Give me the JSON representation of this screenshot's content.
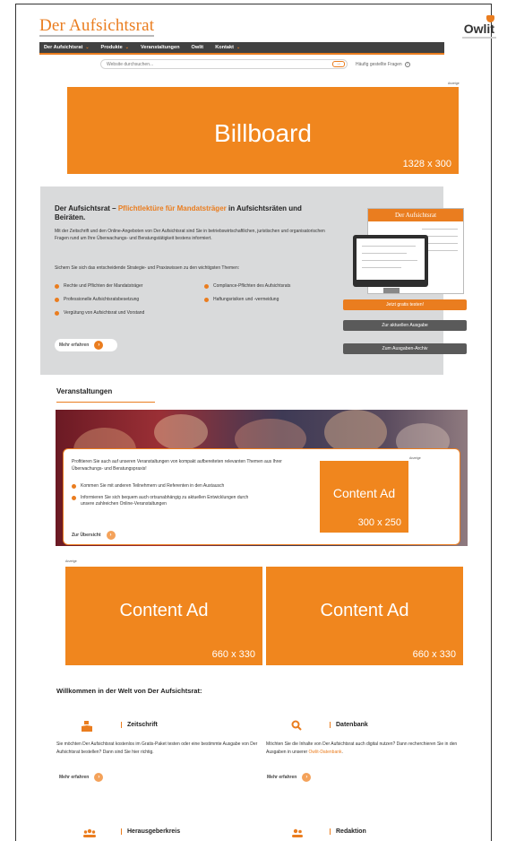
{
  "header": {
    "logo": "Der Aufsichtsrat",
    "brand": "Owlit",
    "nav": [
      {
        "label": "Der Aufsichtsrat",
        "has_dropdown": true
      },
      {
        "label": "Produkte",
        "has_dropdown": true
      },
      {
        "label": "Veranstaltungen",
        "has_dropdown": false
      },
      {
        "label": "Owlit",
        "has_dropdown": false
      },
      {
        "label": "Kontakt",
        "has_dropdown": true
      }
    ],
    "search_placeholder": "Website durchsuchen...",
    "search_button": "→",
    "faq": "Häufig gestellte Fragen",
    "faq_icon": "?"
  },
  "colors": {
    "accent": "#ea7d1f",
    "nav_bg": "#414141",
    "feature_bg": "#d9dadb",
    "ad_bg": "#f0861e"
  },
  "ads": {
    "label": "Anzeige",
    "billboard": {
      "title": "Billboard",
      "size": "1328 x 300"
    },
    "event_ad": {
      "title": "Content Ad",
      "size": "300 x 250"
    },
    "content_left": {
      "title": "Content Ad",
      "size": "660 x 330"
    },
    "content_right": {
      "title": "Content Ad",
      "size": "660 x 330"
    }
  },
  "feature": {
    "heading_pre": "Der Aufsichtsrat – ",
    "heading_highlight": "Pflichtlektüre für Mandatsträger",
    "heading_post": " in Aufsichtsräten und Beiräten.",
    "intro": "Mit der Zeitschrift und den Online-Angeboten von Der Aufsichtsrat sind Sie in betriebswirtschaftlichen, juristischen und organisatorischen Fragen rund um Ihre Überwachungs- und Beratungstätigkeit bestens informiert.",
    "lead": "Sichern Sie sich das entscheidende Strategie- und Praxiswissen zu den wichtigsten Themen:",
    "topics_left": [
      "Rechte und Pflichten der Mandatsträger",
      "Professionelle Aufsichtsratsbesetzung",
      "Vergütung von Aufsichtsrat und Vorstand"
    ],
    "topics_right": [
      "Compliance-Pflichten des Aufsichtsrats",
      "Haftungsrisiken und -vermeidung"
    ],
    "more": "Mehr erfahren",
    "magazine_title": "Der Aufsichtsrat",
    "buttons": {
      "trial": "Jetzt gratis testen!",
      "current": "Zur aktuellen Ausgabe",
      "archive": "Zum Ausgaben-Archiv"
    }
  },
  "events": {
    "title": "Veranstaltungen",
    "lead": "Profitieren Sie auch auf unseren Veranstaltungen von kompakt aufbereiteten relevanten Themen aus Ihrer Überwachungs- und Beratungspraxis!",
    "bullets": [
      "Kommen Sie mit anderen Teilnehmern und Referenten in den Austausch",
      "Informieren Sie sich bequem auch ortsunabhängig zu aktuellen Entwicklungen durch unsere zahlreichen Online-Veranstaltungen"
    ],
    "overview": "Zur Übersicht"
  },
  "welcome": {
    "title": "Willkommen in der Welt von Der Aufsichtsrat:",
    "cards": [
      {
        "title": "Zeitschrift",
        "icon": "book-hand-icon",
        "text": "Sie möchten Der Aufsichtsrat kostenlos im Gratis-Paket testen oder eine bestimmte Ausgabe von Der Aufsichtsrat bestellen? Dann sind Sie hier richtig.",
        "more": "Mehr erfahren"
      },
      {
        "title": "Datenbank",
        "icon": "search-icon",
        "text_pre": "Möchten Sie die Inhalte von Der Aufsichtsrat auch digital nutzen? Dann recherchieren Sie in den Ausgaben in unserer ",
        "link": "Owlit-Datenbank",
        "text_post": ".",
        "more": "Mehr erfahren"
      },
      {
        "title": "Herausgeberkreis",
        "icon": "people-group-icon"
      },
      {
        "title": "Redaktion",
        "icon": "people-pair-icon"
      }
    ]
  }
}
